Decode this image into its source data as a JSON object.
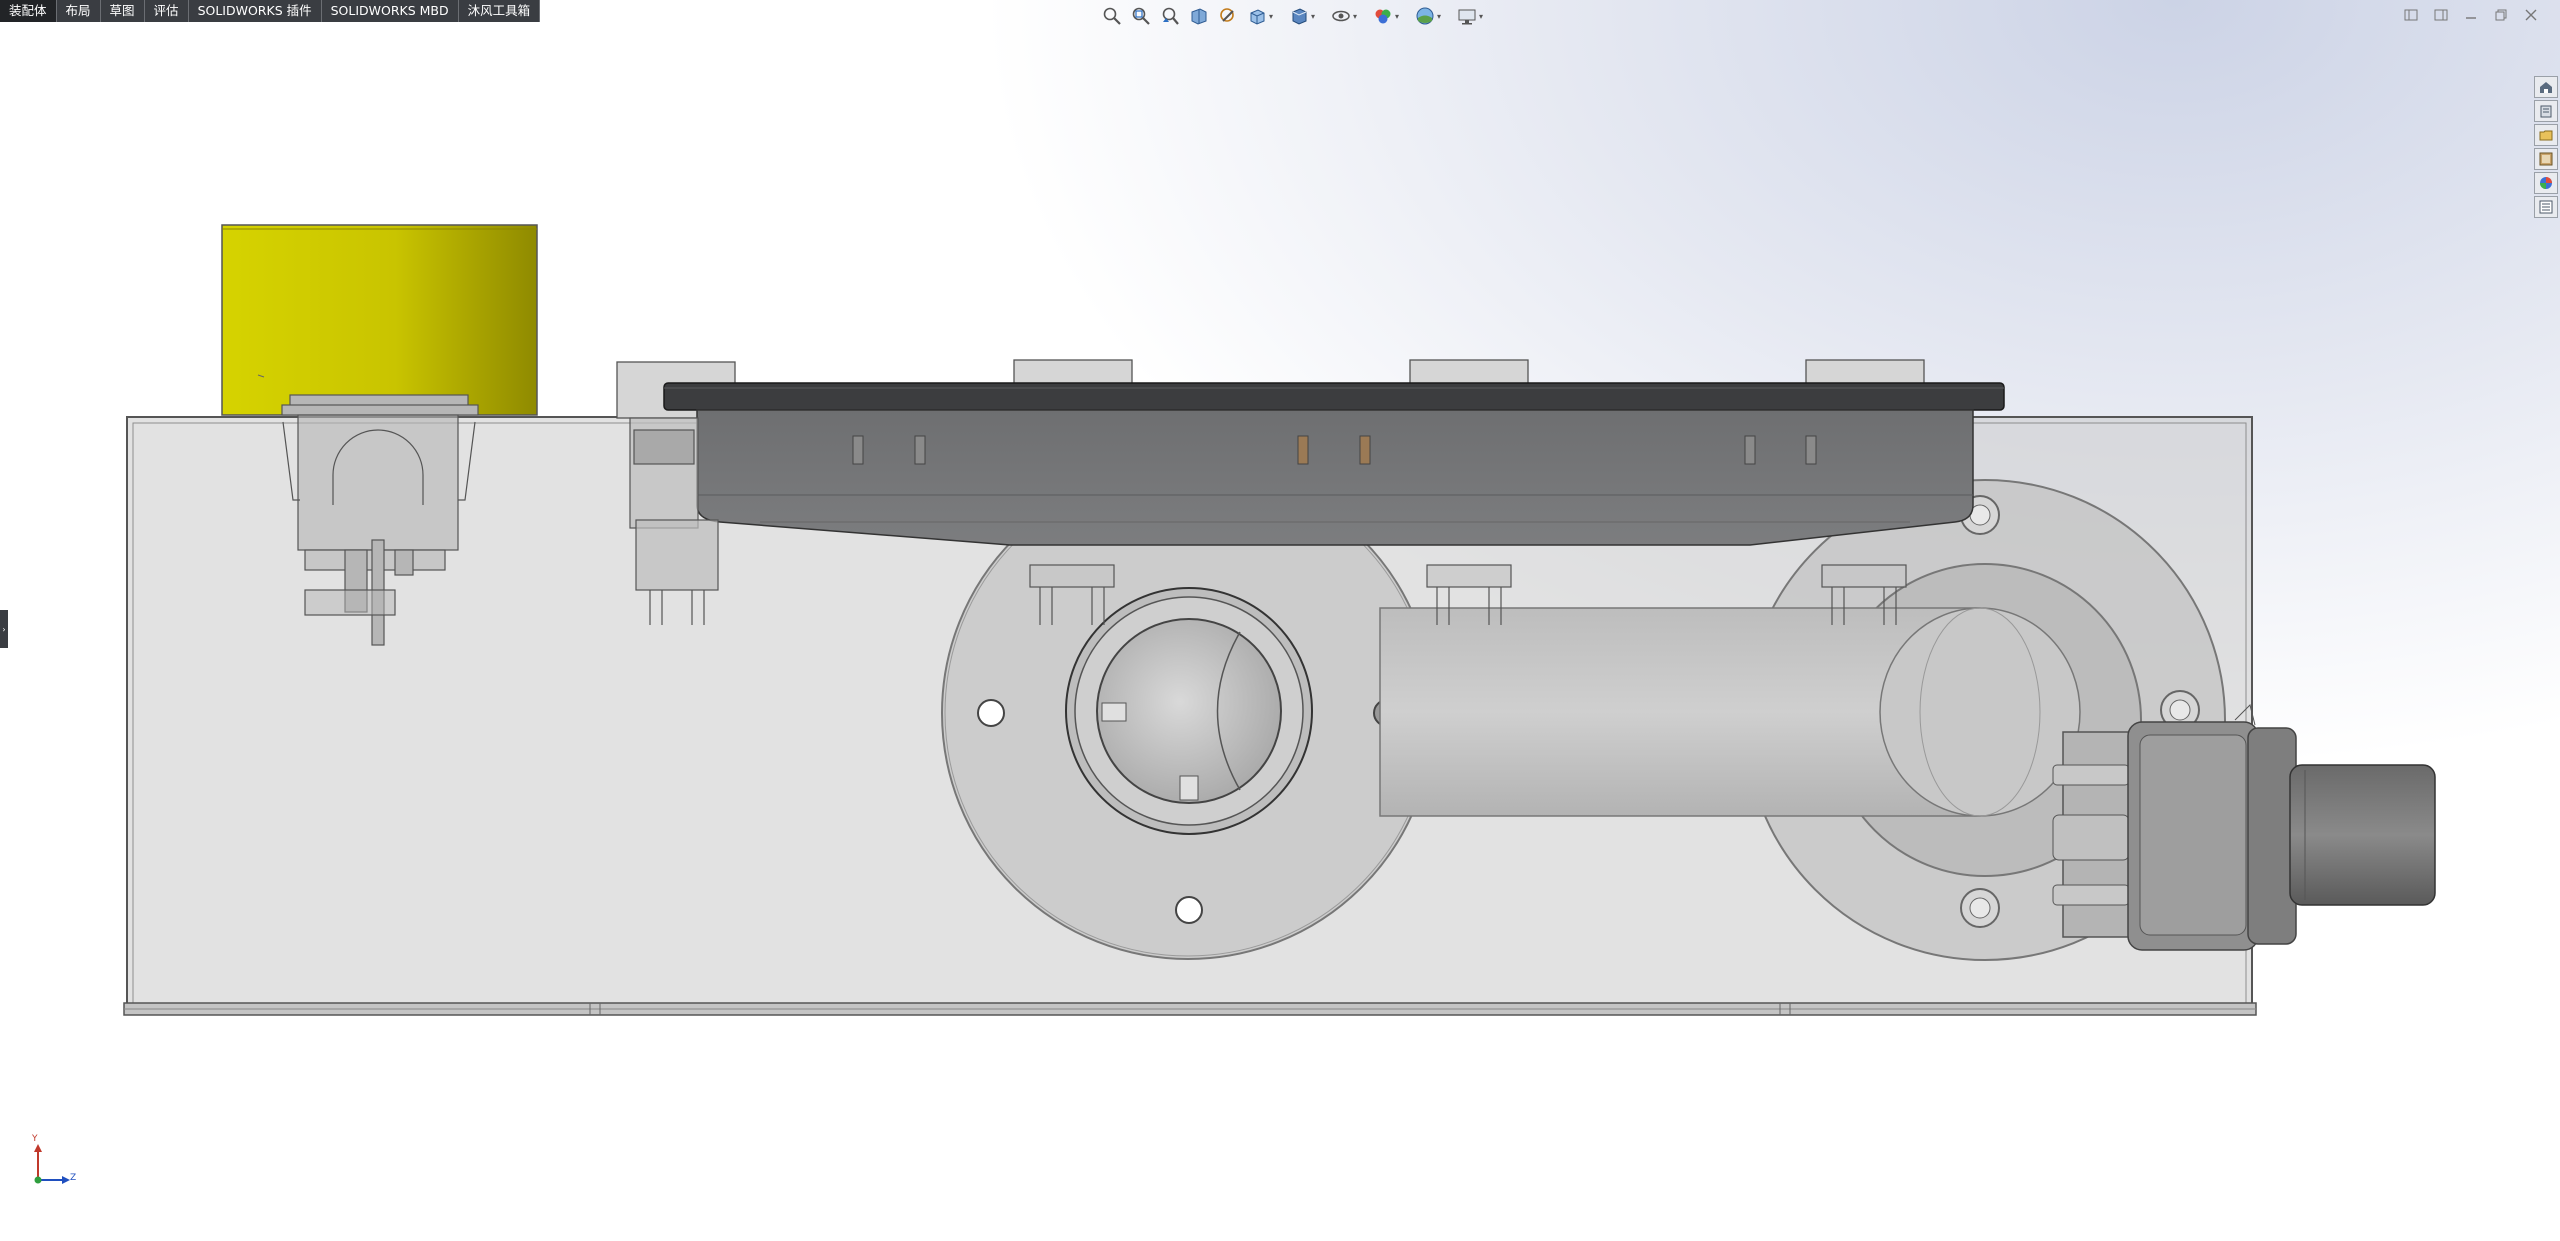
{
  "command_manager": {
    "tabs": [
      {
        "label": "装配体",
        "active": true
      },
      {
        "label": "布局",
        "active": false
      },
      {
        "label": "草图",
        "active": false
      },
      {
        "label": "评估",
        "active": false
      },
      {
        "label": "SOLIDWORKS 插件",
        "active": false
      },
      {
        "label": "SOLIDWORKS MBD",
        "active": false
      },
      {
        "label": "沐风工具箱",
        "active": false
      }
    ]
  },
  "heads_up_toolbar": [
    "zoom-to-fit-icon",
    "zoom-to-area-icon",
    "previous-view-icon",
    "section-view-icon",
    "dynamic-annotation-icon",
    "view-orientation-icon",
    "display-style-icon",
    "hide-show-items-icon",
    "edit-appearance-icon",
    "apply-scene-icon",
    "view-settings-icon"
  ],
  "task_pane": [
    "solidworks-resources-icon",
    "design-library-icon",
    "file-explorer-icon",
    "view-palette-icon",
    "appearances-icon",
    "custom-properties-icon"
  ],
  "triad": {
    "y_label": "Y",
    "z_label": "Z"
  },
  "colors": {
    "tab_bg": "#3a3d42",
    "enclosure": "#c9c9c9",
    "yellow_cap": "#c8c400",
    "dark_lid": "#3c3d3f"
  }
}
